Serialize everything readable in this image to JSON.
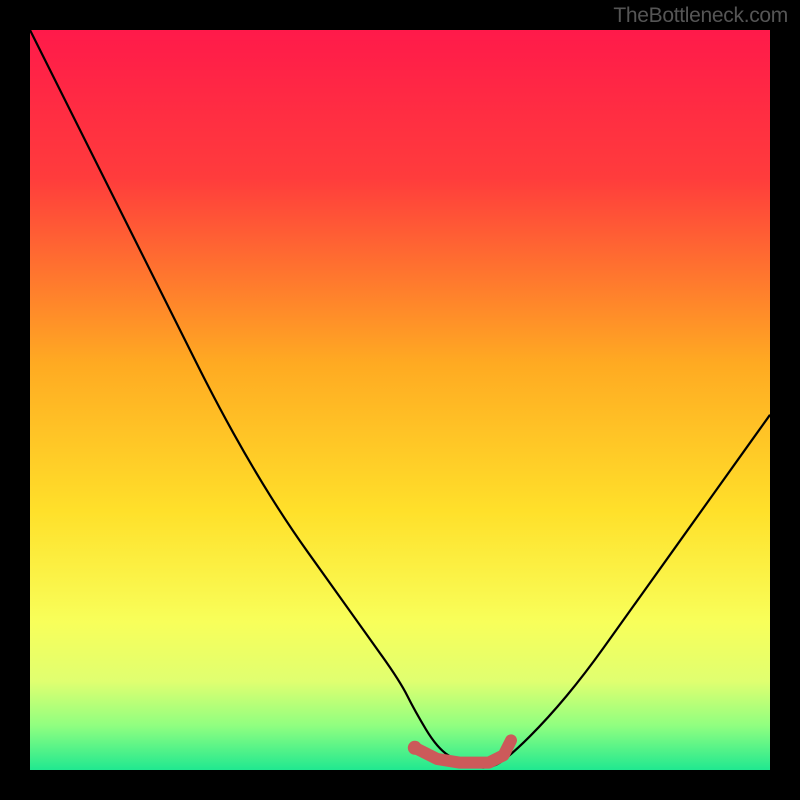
{
  "attribution": "TheBottleneck.com",
  "chart_data": {
    "type": "line",
    "title": "",
    "xlabel": "",
    "ylabel": "",
    "xlim": [
      0,
      100
    ],
    "ylim": [
      0,
      100
    ],
    "series": [
      {
        "name": "bottleneck-curve",
        "x": [
          0,
          5,
          10,
          15,
          20,
          25,
          30,
          35,
          40,
          45,
          50,
          52,
          55,
          58,
          62,
          65,
          70,
          75,
          80,
          85,
          90,
          95,
          100
        ],
        "y": [
          100,
          90,
          80,
          70,
          60,
          50,
          41,
          33,
          26,
          19,
          12,
          8,
          3,
          1,
          0,
          2,
          7,
          13,
          20,
          27,
          34,
          41,
          48
        ]
      },
      {
        "name": "optimal-range-marker",
        "x": [
          52,
          55,
          58,
          62,
          64,
          65
        ],
        "y": [
          3,
          1.5,
          1,
          1,
          2,
          4
        ]
      }
    ],
    "gradient_stops": [
      {
        "offset": 0,
        "color": "#ff1a4a"
      },
      {
        "offset": 20,
        "color": "#ff3c3c"
      },
      {
        "offset": 45,
        "color": "#ffaa22"
      },
      {
        "offset": 65,
        "color": "#ffe02a"
      },
      {
        "offset": 80,
        "color": "#f8ff5a"
      },
      {
        "offset": 88,
        "color": "#e0ff70"
      },
      {
        "offset": 94,
        "color": "#90ff80"
      },
      {
        "offset": 100,
        "color": "#20e890"
      }
    ]
  }
}
